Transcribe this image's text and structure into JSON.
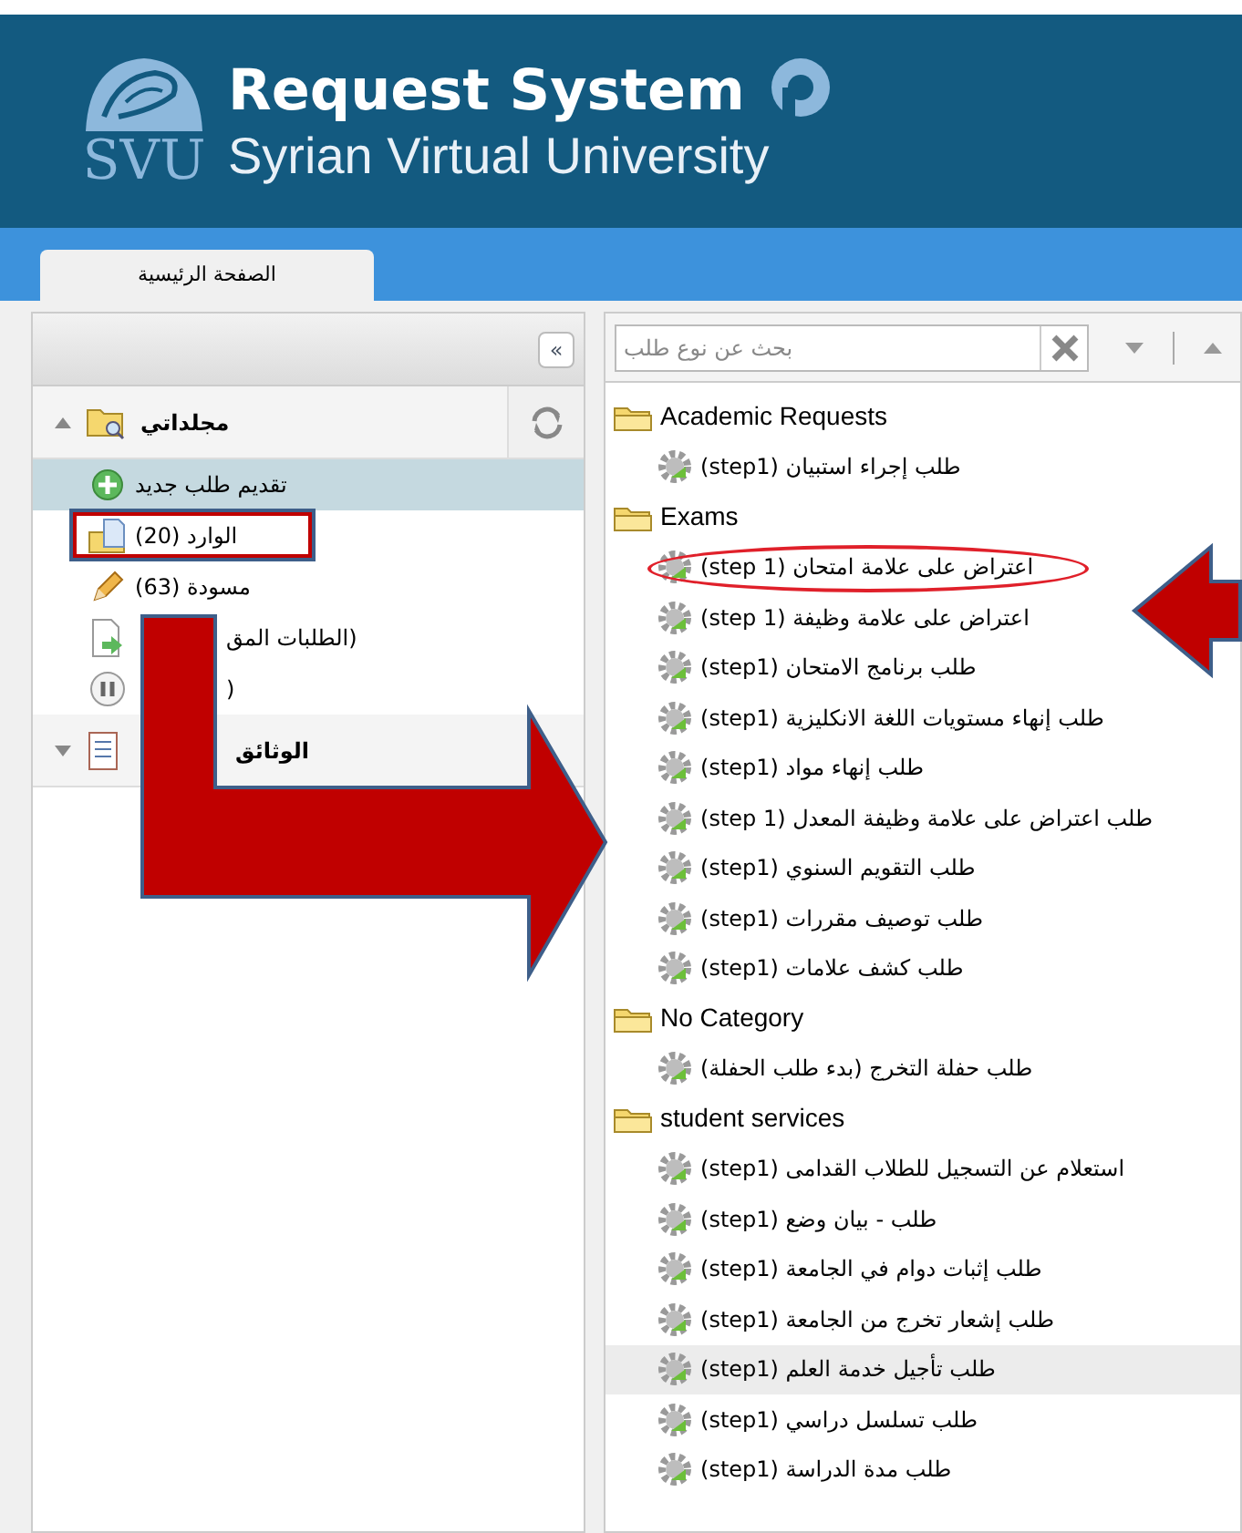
{
  "header": {
    "logo_text": "SVU",
    "title": "Request System",
    "subtitle": "Syrian Virtual University"
  },
  "tabs": [
    {
      "label": "الصفحة الرئيسية",
      "selected": true
    }
  ],
  "left_panel": {
    "collapse_button": "«",
    "sections": [
      {
        "title": "مجلداتي",
        "expanded": true,
        "items": [
          {
            "kind": "new",
            "label": "تقديم طلب جديد",
            "selected": true,
            "boxed": false
          },
          {
            "kind": "inbox",
            "label": "الوارد (20)",
            "selected": false,
            "boxed": true
          },
          {
            "kind": "draft",
            "label": "مسودة (63)",
            "selected": false,
            "boxed": false
          },
          {
            "kind": "sent",
            "label": "(الطلبات المق",
            "selected": false,
            "boxed": false
          },
          {
            "kind": "paused",
            "label": "(",
            "selected": false,
            "boxed": false
          }
        ]
      },
      {
        "title": "الوثائق",
        "expanded": false
      }
    ]
  },
  "right_panel": {
    "search": {
      "placeholder": "بحث عن نوع طلب"
    },
    "categories": [
      {
        "name": "Academic Requests",
        "items": [
          {
            "label": "طلب إجراء استبيان (step1)",
            "selected": false,
            "circled": false
          }
        ]
      },
      {
        "name": "Exams",
        "items": [
          {
            "label": "اعتراض على علامة امتحان (step 1)",
            "selected": false,
            "circled": true
          },
          {
            "label": "اعتراض على علامة وظيفة (step 1)",
            "selected": false,
            "circled": false
          },
          {
            "label": "طلب برنامج الامتحان (step1)",
            "selected": false,
            "circled": false
          },
          {
            "label": "طلب إنهاء مستويات اللغة الانكليزية (step1)",
            "selected": false,
            "circled": false
          },
          {
            "label": "طلب إنهاء مواد (step1)",
            "selected": false,
            "circled": false
          },
          {
            "label": "طلب اعتراض على علامة وظيفة المعدل (step 1)",
            "selected": false,
            "circled": false
          },
          {
            "label": "طلب التقويم السنوي (step1)",
            "selected": false,
            "circled": false
          },
          {
            "label": "طلب توصيف مقررات (step1)",
            "selected": false,
            "circled": false
          },
          {
            "label": "طلب كشف علامات (step1)",
            "selected": false,
            "circled": false
          }
        ]
      },
      {
        "name": "No Category",
        "items": [
          {
            "label": "طلب حفلة التخرج (بدء طلب الحفلة)",
            "selected": false,
            "circled": false
          }
        ]
      },
      {
        "name": "student services",
        "items": [
          {
            "label": "استعلام عن التسجيل للطلاب القدامى (step1)",
            "selected": false,
            "circled": false
          },
          {
            "label": "طلب - بيان وضع (step1)",
            "selected": false,
            "circled": false
          },
          {
            "label": "طلب إثبات دوام في الجامعة (step1)",
            "selected": false,
            "circled": false
          },
          {
            "label": "طلب إشعار تخرج من الجامعة (step1)",
            "selected": false,
            "circled": false
          },
          {
            "label": "طلب تأجيل خدمة العلم (step1)",
            "selected": true,
            "circled": false
          },
          {
            "label": "طلب تسلسل دراسي (step1)",
            "selected": false,
            "circled": false
          },
          {
            "label": "طلب مدة الدراسة (step1)",
            "selected": false,
            "circled": false
          }
        ]
      }
    ]
  },
  "annotations": {
    "bent_arrow": true,
    "left_arrow": true
  }
}
